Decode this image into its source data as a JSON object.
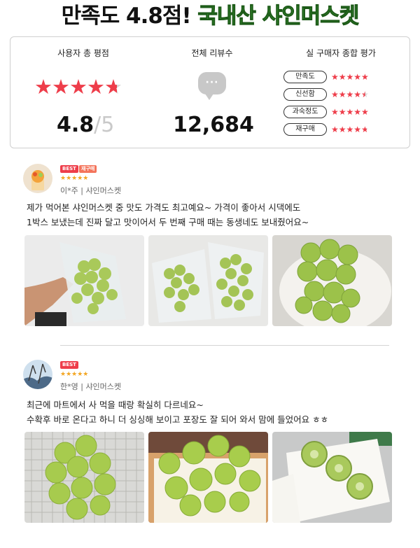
{
  "header": {
    "part1": "만족도 4.8점!",
    "part2": "국내산 샤인머스켓"
  },
  "summary": {
    "rating_title": "사용자 총 평점",
    "reviews_title": "전체 리뷰수",
    "buyer_title": "실 구매자 종합 평가",
    "star_rating": 4.8,
    "score": "4.8",
    "score_max": "/5",
    "bubble_icon": "chat-bubble-icon",
    "review_count": "12,684",
    "categories": [
      {
        "label": "만족도",
        "stars": 5
      },
      {
        "label": "신선함",
        "stars": 4.5
      },
      {
        "label": "과숙정도",
        "stars": 5
      },
      {
        "label": "재구매",
        "stars": 4.8
      }
    ],
    "star_color": "#ee3d4a"
  },
  "reviews": [
    {
      "badges": [
        "BEST",
        "재구매"
      ],
      "stars": 5,
      "user": "이*주 | 샤인머스켓",
      "text_lines": [
        "제가 먹어본 샤인머스켓 중 맛도 가격도 최고예요~ 가격이 좋아서 시댁에도",
        "1박스 보냈는데 진짜 달고 맛이어서 두 번째 구매 때는 동생네도 보내줬어요~"
      ]
    },
    {
      "badges": [
        "BEST"
      ],
      "stars": 5,
      "user": "한*영 | 샤인머스켓",
      "text_lines": [
        "최근에 마트에서 사 먹을 때랑 확실히 다르네요~",
        "수확후 바로 온다고 하니 더 싱싱해 보이고 포장도 잘 되어 와서 맘에 들었어요 ㅎㅎ"
      ]
    }
  ]
}
